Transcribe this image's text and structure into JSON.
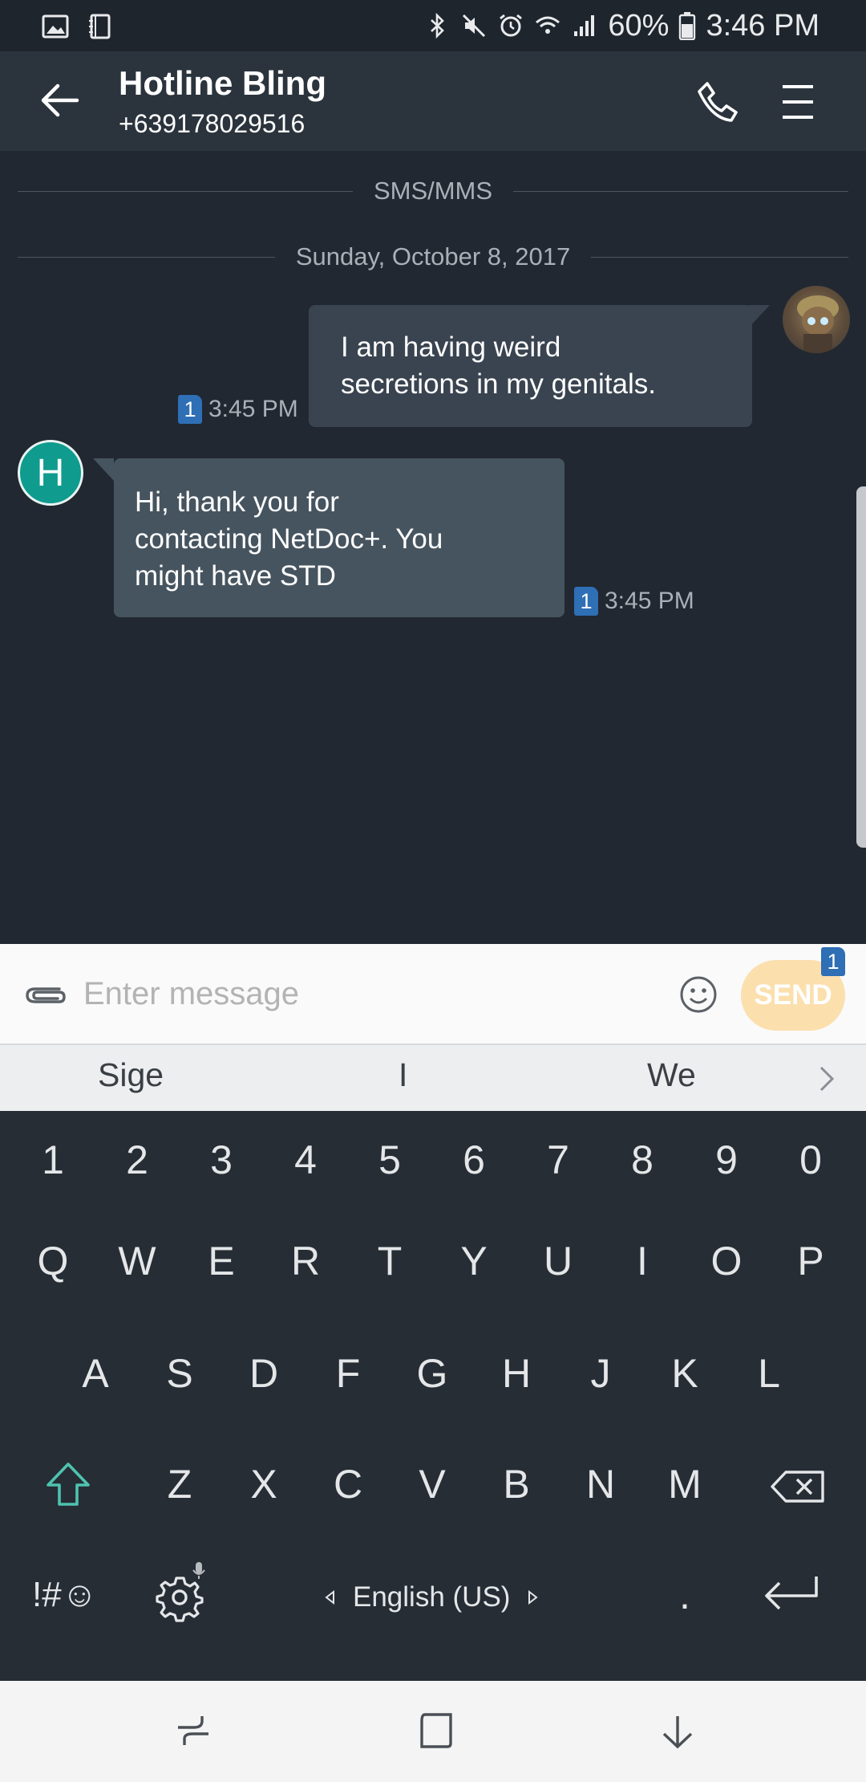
{
  "status_bar": {
    "battery": "60%",
    "time": "3:46 PM"
  },
  "header": {
    "title": "Hotline Bling",
    "phone_number": "+639178029516"
  },
  "conversation": {
    "channel_label": "SMS/MMS",
    "date_label": "Sunday, October 8, 2017",
    "messages": [
      {
        "direction": "outgoing",
        "text_line1": "I am having weird",
        "text_line2": "secretions in my genitals.",
        "sim": "1",
        "time": "3:45 PM"
      },
      {
        "direction": "incoming",
        "avatar_letter": "H",
        "text_line1": "Hi, thank you for",
        "text_line2": "contacting NetDoc+. You",
        "text_line3": "might have STD",
        "sim": "1",
        "time": "3:45 PM"
      }
    ]
  },
  "composer": {
    "placeholder": "Enter message",
    "send_label": "SEND",
    "send_sim": "1"
  },
  "suggestions": [
    "Sige",
    "I",
    "We"
  ],
  "keyboard": {
    "row_numbers": [
      "1",
      "2",
      "3",
      "4",
      "5",
      "6",
      "7",
      "8",
      "9",
      "0"
    ],
    "row1": [
      "Q",
      "W",
      "E",
      "R",
      "T",
      "Y",
      "U",
      "I",
      "O",
      "P"
    ],
    "row2": [
      "A",
      "S",
      "D",
      "F",
      "G",
      "H",
      "J",
      "K",
      "L"
    ],
    "row3": [
      "Z",
      "X",
      "C",
      "V",
      "B",
      "N",
      "M"
    ],
    "symbols_label": "!#☺",
    "language": "English (US)",
    "period": "."
  },
  "colors": {
    "background": "#212831",
    "header": "#2b343d",
    "outgoing_bubble": "#3a4450",
    "incoming_bubble": "#46545f",
    "avatar_teal": "#0f9b8e",
    "send_button": "#fbdfad",
    "sim_badge": "#2e6fb5"
  }
}
